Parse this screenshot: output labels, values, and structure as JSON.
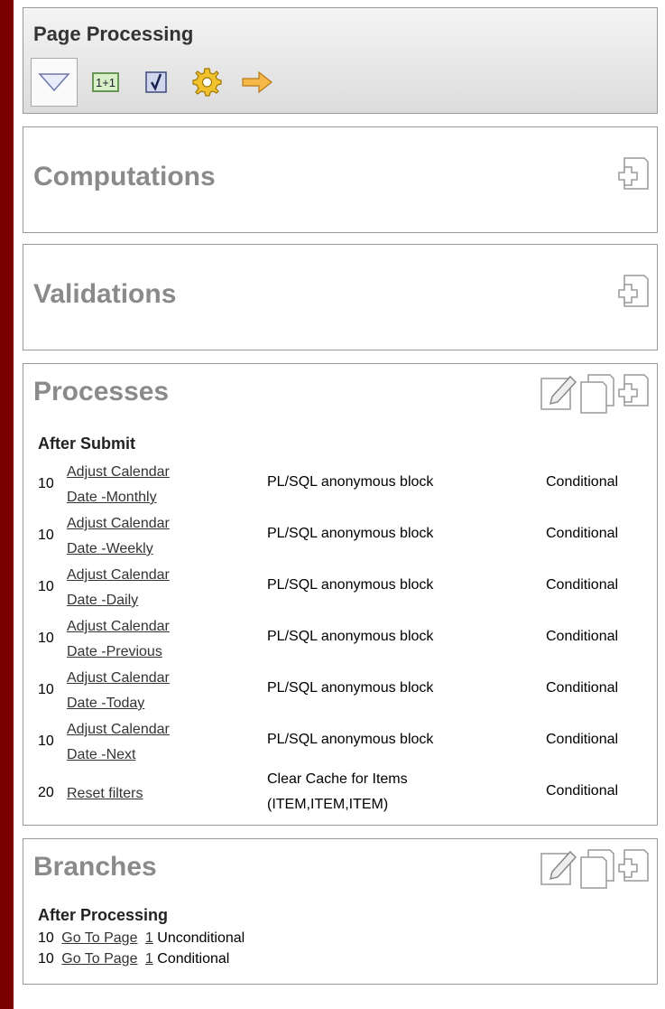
{
  "page_processing": {
    "title": "Page Processing",
    "icons": [
      "triangle-down-icon",
      "one-plus-one-icon",
      "checkbox-icon",
      "gear-icon",
      "arrow-right-icon"
    ]
  },
  "computations": {
    "title": "Computations",
    "icons": [
      "add-icon"
    ]
  },
  "validations": {
    "title": "Validations",
    "icons": [
      "add-icon"
    ]
  },
  "processes": {
    "title": "Processes",
    "icons": [
      "edit-icon",
      "copy-icon",
      "add-icon"
    ],
    "group": "After Submit",
    "rows": [
      {
        "seq": "10",
        "name1": "Adjust Calendar",
        "name2": "Date -Monthly",
        "type": "PL/SQL anonymous block",
        "cond": "Conditional"
      },
      {
        "seq": "10",
        "name1": "Adjust Calendar",
        "name2": "Date -Weekly",
        "type": "PL/SQL anonymous block",
        "cond": "Conditional"
      },
      {
        "seq": "10",
        "name1": "Adjust Calendar",
        "name2": "Date -Daily",
        "type": "PL/SQL anonymous block",
        "cond": "Conditional"
      },
      {
        "seq": "10",
        "name1": "Adjust Calendar",
        "name2": "Date -Previous",
        "type": "PL/SQL anonymous block",
        "cond": "Conditional"
      },
      {
        "seq": "10",
        "name1": "Adjust Calendar",
        "name2": "Date -Today",
        "type": "PL/SQL anonymous block",
        "cond": "Conditional"
      },
      {
        "seq": "10",
        "name1": "Adjust Calendar",
        "name2": "Date -Next",
        "type": "PL/SQL anonymous block",
        "cond": "Conditional"
      },
      {
        "seq": "20",
        "name1": "Reset filters",
        "type1": "Clear Cache for Items",
        "type2": "(ITEM,ITEM,ITEM)",
        "cond": "Conditional"
      }
    ]
  },
  "branches": {
    "title": "Branches",
    "icons": [
      "edit-icon",
      "copy-icon",
      "add-icon"
    ],
    "group": "After Processing",
    "rows": [
      {
        "seq": "10",
        "link": "Go To Page",
        "page": "1",
        "cond": "Unconditional"
      },
      {
        "seq": "10",
        "link": "Go To Page",
        "page": "1",
        "cond": "Conditional"
      }
    ]
  }
}
